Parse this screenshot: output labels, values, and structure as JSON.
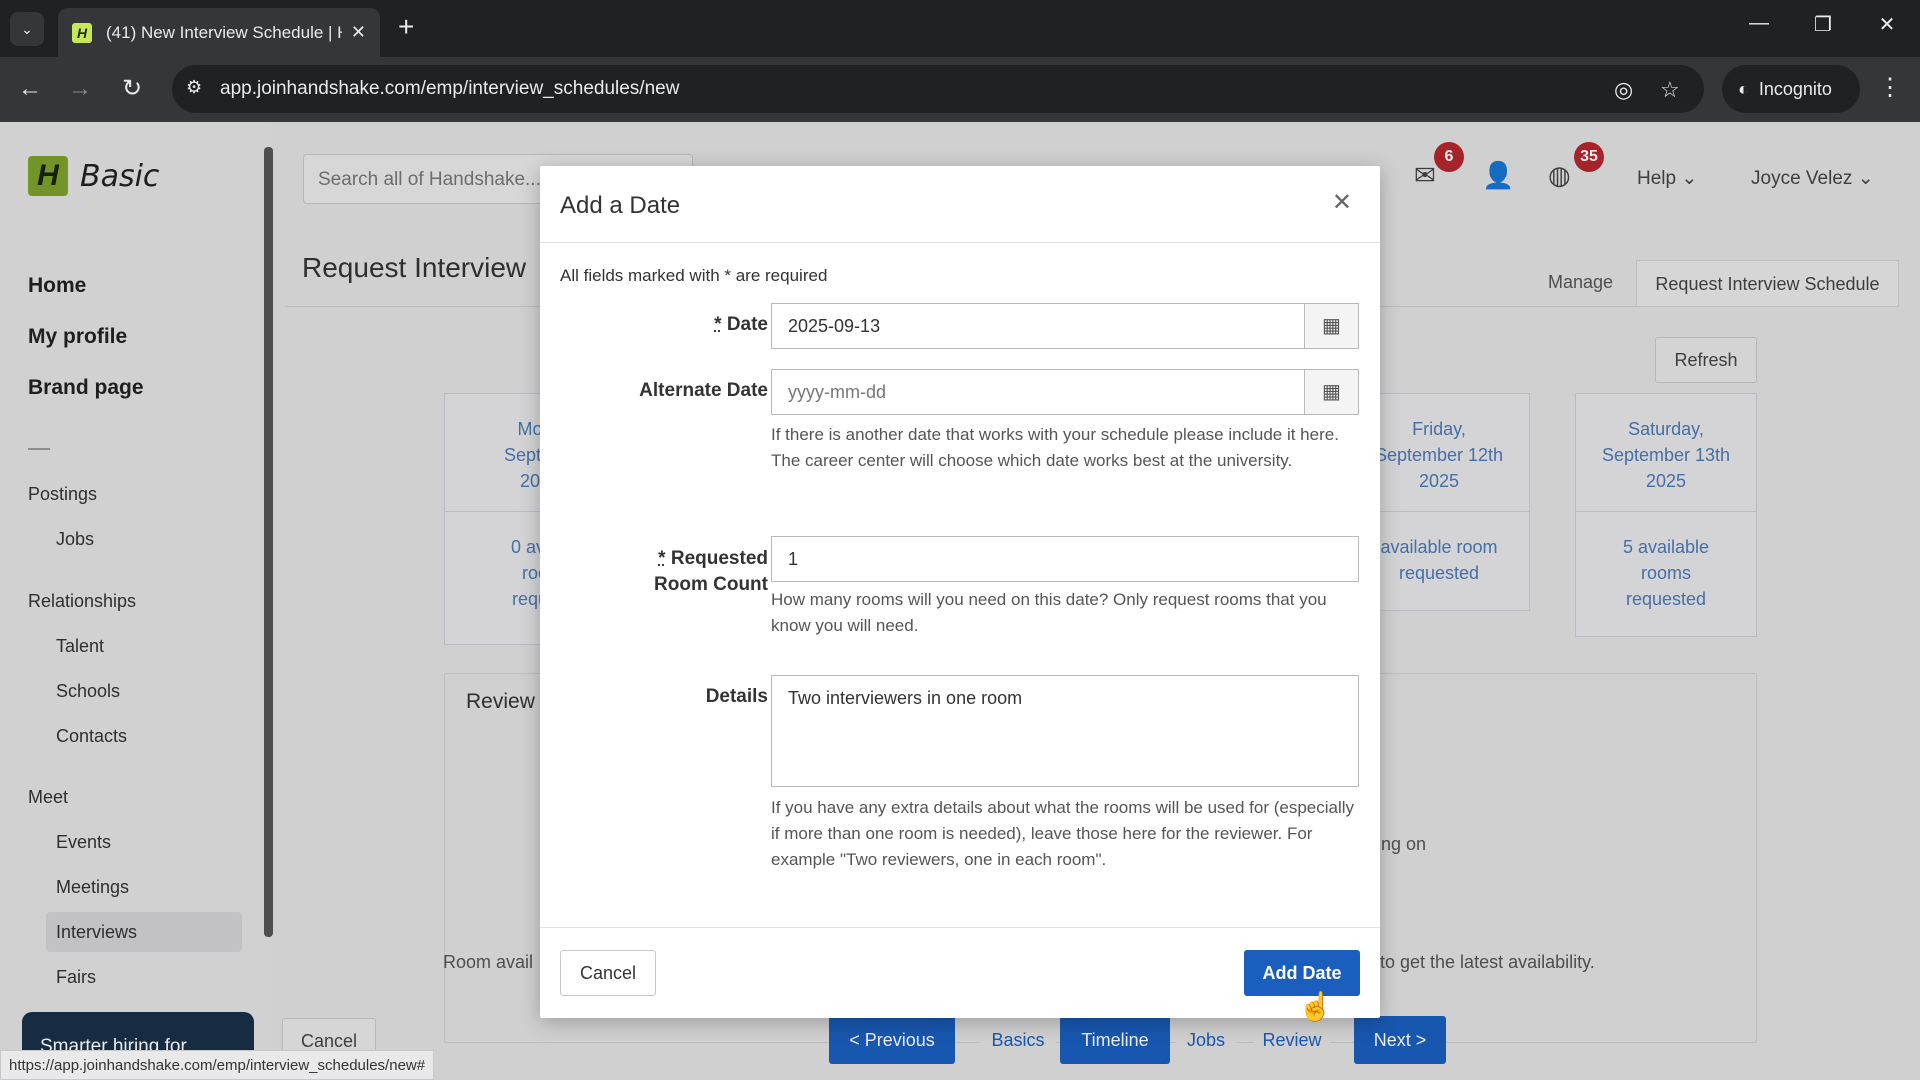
{
  "browser": {
    "tab_title": "(41) New Interview Schedule | H",
    "url": "app.joinhandshake.com/emp/interview_schedules/new",
    "incognito_label": "Incognito",
    "status_url": "https://app.joinhandshake.com/emp/interview_schedules/new#"
  },
  "header": {
    "search_placeholder": "Search all of Handshake...",
    "messages_badge": "6",
    "globe_badge": "35",
    "help_label": "Help",
    "user_name": "Joyce Velez"
  },
  "sidebar": {
    "logo_text": "Basic",
    "main_items": [
      "Home",
      "My profile",
      "Brand page"
    ],
    "sections": {
      "postings": "Postings",
      "jobs": "Jobs",
      "relationships": "Relationships",
      "talent": "Talent",
      "schools": "Schools",
      "contacts": "Contacts",
      "meet": "Meet",
      "events": "Events",
      "meetings": "Meetings",
      "interviews": "Interviews",
      "fairs": "Fairs"
    },
    "promo_text": "Smarter hiring for"
  },
  "page": {
    "title": "Request Interview",
    "tab_manage": "Manage",
    "tab_request": "Request Interview Schedule",
    "refresh_label": "Refresh",
    "day_cards": [
      {
        "head": "Mon\nSeptem\n202",
        "body": "0 avai\nroo\nreque"
      },
      {
        "head": "Friday,\nSeptember 12th\n2025",
        "body": "available room\nrequested"
      },
      {
        "head": "Saturday,\nSeptember 13th\n2025",
        "body": "5 available\nrooms\nrequested"
      }
    ],
    "review_title": "Review",
    "bg_ing_on": "ing on",
    "room_avail_left": "Room avail",
    "room_avail_right": "to get the latest availability.",
    "bottom_cancel": "Cancel",
    "wizard": {
      "previous": "< Previous",
      "basics": "Basics",
      "timeline": "Timeline",
      "jobs": "Jobs",
      "review": "Review",
      "next": "Next >"
    }
  },
  "modal": {
    "title": "Add a Date",
    "required_note": "All fields marked with * are required",
    "date_label": "Date",
    "date_value": "2025-09-13",
    "alt_date_label": "Alternate Date",
    "alt_date_placeholder": "yyyy-mm-dd",
    "alt_date_help": "If there is another date that works with your schedule please include it here. The career center will choose which date works best at the university.",
    "room_count_label_1": "Requested",
    "room_count_label_2": "Room Count",
    "room_count_value": "1",
    "room_count_help": "How many rooms will you need on this date? Only request rooms that you know you will need.",
    "details_label": "Details",
    "details_value": "Two interviewers in one room",
    "details_help": "If you have any extra details about what the rooms will be used for (especially if more than one room is needed), leave those here for the reviewer. For example \"Two reviewers, one in each room\".",
    "cancel_label": "Cancel",
    "submit_label": "Add Date"
  },
  "colors": {
    "primary_blue": "#1b5fbe",
    "badge_red": "#b5282d",
    "logo_green": "#7ca12c"
  }
}
